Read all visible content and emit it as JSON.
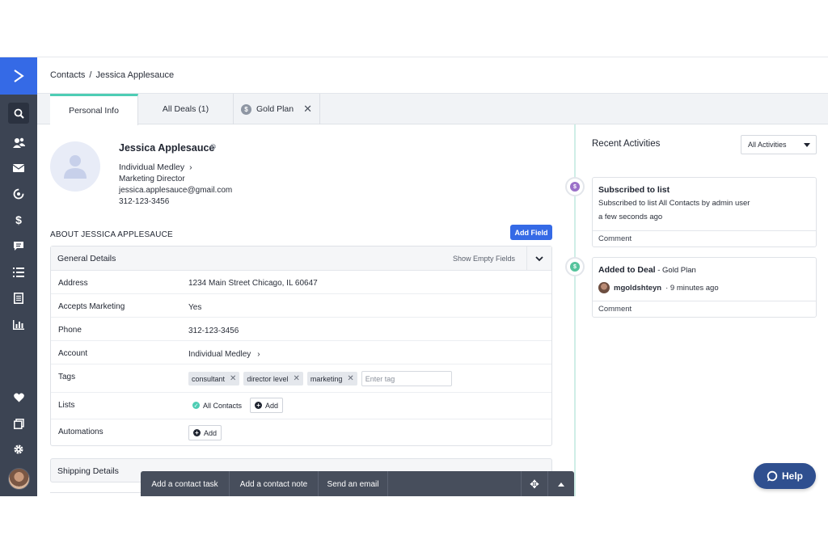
{
  "breadcrumb": {
    "root": "Contacts",
    "separator": "/",
    "current": "Jessica Applesauce"
  },
  "tabs": {
    "personal": "Personal Info",
    "deals": "All Deals (1)",
    "gold": "Gold Plan",
    "gold_coin": "$",
    "close": "✕"
  },
  "contact": {
    "name": "Jessica Applesauce",
    "account": "Individual Medley",
    "title": "Marketing Director",
    "email": "jessica.applesauce@gmail.com",
    "phone": "312-123-3456"
  },
  "about": {
    "heading": "ABOUT JESSICA APPLESAUCE",
    "add_field": "Add Field"
  },
  "details": {
    "title": "General Details",
    "show_empty": "Show Empty Fields",
    "address_label": "Address",
    "address_value": "1234 Main Street Chicago, IL 60647",
    "marketing_label": "Accepts Marketing",
    "marketing_value": "Yes",
    "phone_label": "Phone",
    "phone_value": "312-123-3456",
    "account_label": "Account",
    "account_value": "Individual Medley",
    "tags_label": "Tags",
    "tags": [
      "consultant",
      "director level",
      "marketing"
    ],
    "tag_placeholder": "Enter tag",
    "lists_label": "Lists",
    "list_name": "All Contacts",
    "add_label": "Add",
    "automations_label": "Automations"
  },
  "shipping": {
    "title": "Shipping Details"
  },
  "activities": {
    "title": "Recent Activities",
    "filter": "All Activities",
    "items": [
      {
        "title": "Subscribed to list",
        "text": "Subscribed to list All Contacts by admin user",
        "time": "a few seconds ago",
        "comment": "Comment",
        "icon": "$"
      },
      {
        "title": "Added to Deal",
        "suffix": " - Gold Plan",
        "user": "mgoldshteyn",
        "time": " · 9 minutes ago",
        "comment": "Comment",
        "icon": "$"
      }
    ]
  },
  "actions": {
    "task": "Add a contact task",
    "note": "Add a contact note",
    "email": "Send an email",
    "move": "✥"
  },
  "help": "Help",
  "colors": {
    "brand": "#356ae6",
    "sidebar": "#3c4453",
    "accent": "#4ecdb4",
    "help": "#2f4f8f"
  }
}
